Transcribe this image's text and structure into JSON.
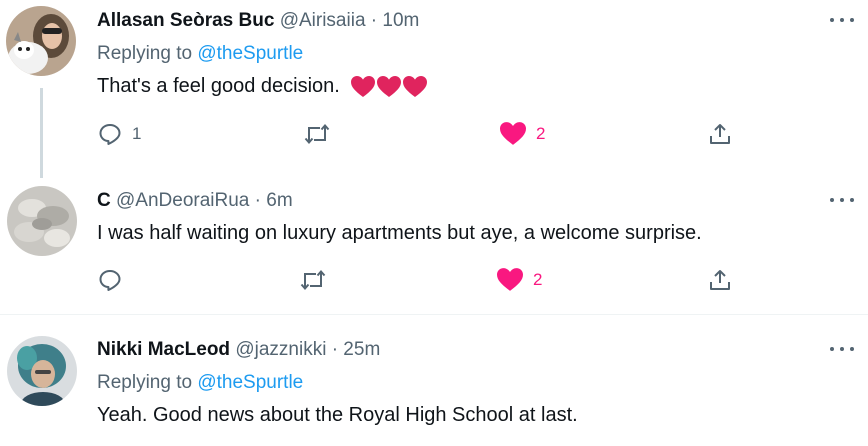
{
  "tweets": [
    {
      "name": "Allasan Seòras Buc",
      "handle": "@Airisaiia",
      "time": "· 10m",
      "reply_prefix": "Replying to",
      "reply_to": "@theSpurtle",
      "text": "That's a feel good decision.",
      "emoji": [
        "red-heart",
        "red-heart",
        "red-heart"
      ],
      "replies": "1",
      "likes": "2"
    },
    {
      "name": "C",
      "handle": "@AnDeoraiRua",
      "time": "· 6m",
      "text": "I was half waiting on luxury apartments but aye, a welcome surprise.",
      "replies": "",
      "likes": "2"
    },
    {
      "name": "Nikki MacLeod",
      "handle": "@jazznikki",
      "time": "· 25m",
      "reply_prefix": "Replying to",
      "reply_to": "@theSpurtle",
      "text": "Yeah. Good news about the Royal High School at last."
    }
  ],
  "colors": {
    "like": "#f91880",
    "link": "#1d9bf0",
    "muted": "#536471",
    "heart": "#e0245e"
  }
}
